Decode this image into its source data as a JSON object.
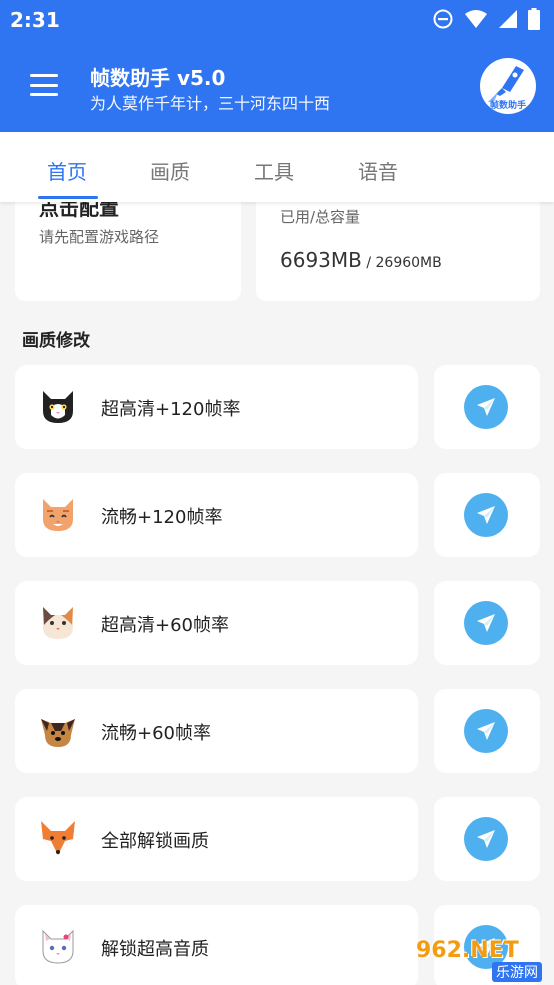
{
  "status_bar": {
    "time": "2:31"
  },
  "header": {
    "title": "帧数助手 v5.0",
    "subtitle": "为人莫作千年计，三十河东四十西",
    "logo_text": "帧数助手"
  },
  "tabs": [
    {
      "label": "首页",
      "active": true
    },
    {
      "label": "画质",
      "active": false
    },
    {
      "label": "工具",
      "active": false
    },
    {
      "label": "语音",
      "active": false
    }
  ],
  "config_card": {
    "title": "点击配置",
    "description": "请先配置游戏路径"
  },
  "storage_card": {
    "label": "已用/总容量",
    "used": "6693MB",
    "separator": " / ",
    "total": "26960MB"
  },
  "section_title": "画质修改",
  "items": [
    {
      "label": "超高清+120帧率",
      "icon": "black-white-cat-icon"
    },
    {
      "label": "流畅+120帧率",
      "icon": "orange-cat-icon"
    },
    {
      "label": "超高清+60帧率",
      "icon": "calico-cat-icon"
    },
    {
      "label": "流畅+60帧率",
      "icon": "yorkie-dog-icon"
    },
    {
      "label": "全部解锁画质",
      "icon": "fox-icon"
    },
    {
      "label": "解锁超高音质",
      "icon": "white-cat-icon"
    }
  ],
  "action_icon": "paper-plane-icon",
  "watermark": {
    "text": "962.NET",
    "subtext": "乐游网"
  },
  "colors": {
    "primary": "#2f74f1",
    "action": "#4fb0ef",
    "background": "#f5f5f5"
  }
}
